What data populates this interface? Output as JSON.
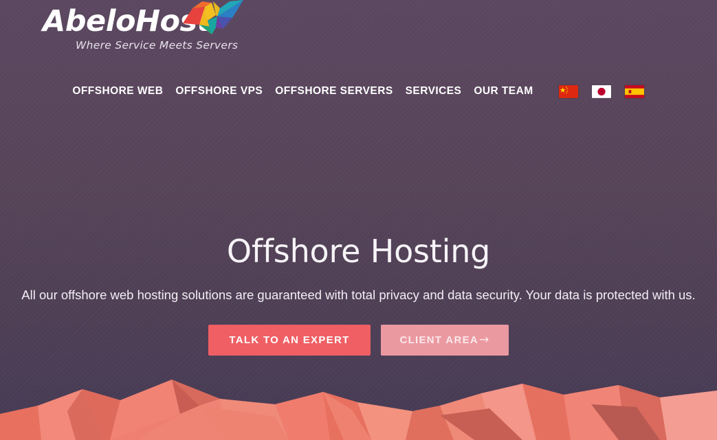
{
  "site": {
    "brand_name": "AbeloHost",
    "tagline": "Where Service Meets Servers",
    "logo_mark_icon": "origami-butterfly-icon"
  },
  "nav": {
    "items": [
      {
        "label": "OFFSHORE WEB",
        "name": "nav-item-offshore-web"
      },
      {
        "label": "OFFSHORE VPS",
        "name": "nav-item-offshore-vps"
      },
      {
        "label": "OFFSHORE SERVERS",
        "name": "nav-item-offshore-servers"
      },
      {
        "label": "SERVICES",
        "name": "nav-item-services"
      },
      {
        "label": "OUR TEAM",
        "name": "nav-item-our-team"
      }
    ],
    "flags": [
      {
        "country": "China",
        "icon": "flag-china-icon"
      },
      {
        "country": "Japan",
        "icon": "flag-japan-icon"
      },
      {
        "country": "Spain",
        "icon": "flag-spain-icon"
      }
    ]
  },
  "hero": {
    "title": "Offshore Hosting",
    "subtitle": "All our offshore web hosting solutions are guaranteed with total privacy and data security. Your data is protected with us.",
    "primary_button": "TALK TO AN EXPERT",
    "secondary_button": "CLIENT AREA",
    "secondary_button_arrow": "→"
  },
  "colors": {
    "background_top": "#5b4760",
    "background_bottom": "#453a55",
    "primary_button": "#ef5f64",
    "secondary_button": "#eb99a1",
    "mountain_base": "#ef7c6e",
    "text_light": "#ffffff"
  }
}
